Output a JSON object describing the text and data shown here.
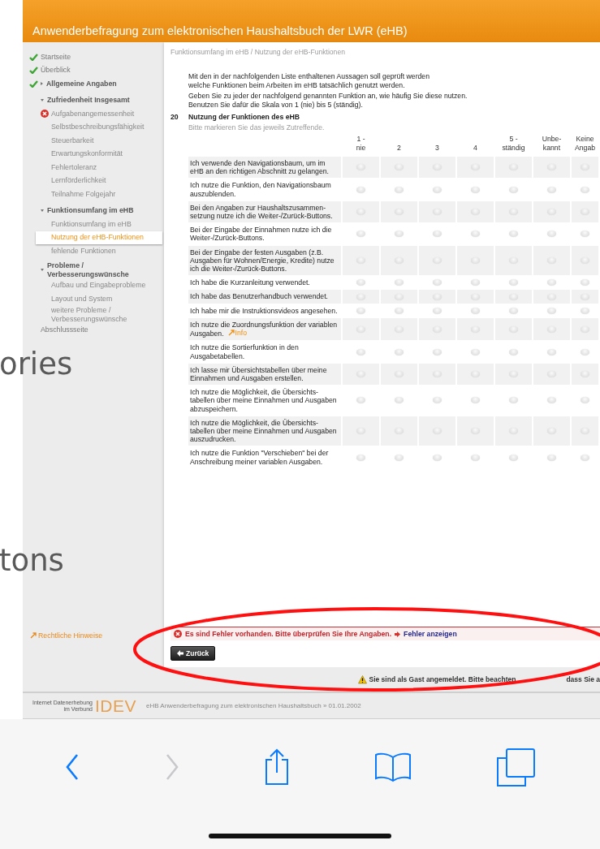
{
  "header": {
    "title": "Anwenderbefragung zum elektronischen Haushaltsbuch der LWR (eHB)"
  },
  "sidebar": {
    "items": [
      {
        "label": "Startseite",
        "kind": "page",
        "done": true,
        "error": false,
        "selected": false
      },
      {
        "label": "Überblick",
        "kind": "page",
        "done": true,
        "error": false,
        "selected": false
      },
      {
        "label": "Allgemeine Angaben",
        "kind": "group",
        "done": true,
        "error": false,
        "expanded": false,
        "selected": false
      },
      {
        "label": "Zufriedenheit Insgesamt",
        "kind": "group",
        "done": false,
        "error": false,
        "expanded": true,
        "selected": false,
        "children": [
          {
            "label": "Aufgabenangemessenheit",
            "done": false,
            "error": true,
            "selected": false
          },
          {
            "label": "Selbstbeschreibungsfähigkeit",
            "done": false,
            "error": false,
            "selected": false
          },
          {
            "label": "Steuerbarkeit",
            "done": false,
            "error": false,
            "selected": false
          },
          {
            "label": "Erwartungskonformität",
            "done": false,
            "error": false,
            "selected": false
          },
          {
            "label": "Fehlertoleranz",
            "done": false,
            "error": false,
            "selected": false
          },
          {
            "label": "Lernförderlichkeit",
            "done": false,
            "error": false,
            "selected": false
          },
          {
            "label": "Teilnahme Folgejahr",
            "done": false,
            "error": false,
            "selected": false
          }
        ]
      },
      {
        "label": "Funktionsumfang im eHB",
        "kind": "group",
        "done": false,
        "error": false,
        "expanded": true,
        "selected": false,
        "children": [
          {
            "label": "Funktionsumfang im eHB",
            "done": false,
            "error": false,
            "selected": false
          },
          {
            "label": "Nutzung der eHB-Funktionen",
            "done": false,
            "error": false,
            "selected": true
          },
          {
            "label": "fehlende Funktionen",
            "done": false,
            "error": false,
            "selected": false
          }
        ]
      },
      {
        "label": "Probleme / Verbesserungswünsche",
        "kind": "group",
        "done": false,
        "error": false,
        "expanded": true,
        "selected": false,
        "children": [
          {
            "label": "Aufbau und Eingabeprobleme",
            "done": false,
            "error": false,
            "selected": false
          },
          {
            "label": "Layout und System",
            "done": false,
            "error": false,
            "selected": false
          },
          {
            "label": "weitere Probleme / Verbesserungswünsche",
            "done": false,
            "error": false,
            "selected": false
          }
        ]
      },
      {
        "label": "Abschlussseite",
        "kind": "page",
        "done": false,
        "error": false,
        "selected": false
      }
    ],
    "legal_link": "Rechtliche Hinweise"
  },
  "content": {
    "breadcrumb": "Funktionsumfang im eHB / Nutzung der eHB-Funktionen",
    "paragraphs": [
      {
        "lines": [
          "Mit den in der nachfolgenden Liste enthaltenen Aussagen soll geprüft werden",
          "welche Funktionen beim Arbeiten im eHB tatsächlich genutzt werden."
        ]
      },
      {
        "lines": [
          "Geben Sie zu jeder der nachfolgend genannten Funktion an, wie häufig Sie diese nutzen.",
          "Benutzen Sie dafür die Skala von 1 (nie) bis 5 (ständig)."
        ]
      }
    ],
    "question": {
      "number": "20",
      "title": "Nutzung der Funktionen des eHB",
      "hint": "Bitte markieren Sie das jeweils Zutreffende."
    },
    "table": {
      "columns": [
        "1 -\nnie",
        "2",
        "3",
        "4",
        "5 -\nständig",
        "Unbe-\nkannt",
        "Keine\nAngab"
      ],
      "rows": [
        {
          "label": "Ich verwende den Navigationsbaum, um im eHB an den richtigen Abschnitt zu gelangen.",
          "radios": [
            {
              "selected": false
            },
            {
              "selected": false
            },
            {
              "selected": false
            },
            {
              "selected": false
            },
            {
              "selected": false
            },
            {
              "selected": false
            },
            {
              "selected": false
            }
          ]
        },
        {
          "label": "Ich nutze die Funktion, den Navigationsbaum auszublenden.",
          "radios": [
            {
              "selected": false
            },
            {
              "selected": false
            },
            {
              "selected": false
            },
            {
              "selected": false
            },
            {
              "selected": false
            },
            {
              "selected": false
            },
            {
              "selected": false
            }
          ]
        },
        {
          "label": "Bei den Angaben zur Haushaltszusammen-setzung nutze ich die Weiter-/Zurück-Buttons.",
          "radios": [
            {
              "selected": false
            },
            {
              "selected": false
            },
            {
              "selected": false
            },
            {
              "selected": false
            },
            {
              "selected": false
            },
            {
              "selected": false
            },
            {
              "selected": false
            }
          ]
        },
        {
          "label": "Bei der Eingabe der Einnahmen nutze ich die Weiter-/Zurück-Buttons.",
          "radios": [
            {
              "selected": false
            },
            {
              "selected": false
            },
            {
              "selected": false
            },
            {
              "selected": false
            },
            {
              "selected": false
            },
            {
              "selected": false
            },
            {
              "selected": false
            }
          ]
        },
        {
          "label": "Bei der Eingabe der festen Ausgaben (z.B. Ausgaben für Wohnen/Energie, Kredite) nutze ich die Weiter-/Zurück-Buttons.",
          "radios": [
            {
              "selected": false
            },
            {
              "selected": false
            },
            {
              "selected": false
            },
            {
              "selected": false
            },
            {
              "selected": false
            },
            {
              "selected": false
            },
            {
              "selected": false
            }
          ]
        },
        {
          "label": "Ich habe die Kurzanleitung verwendet.",
          "radios": [
            {
              "selected": false
            },
            {
              "selected": false
            },
            {
              "selected": false
            },
            {
              "selected": false
            },
            {
              "selected": false
            },
            {
              "selected": false
            },
            {
              "selected": false
            }
          ]
        },
        {
          "label": "Ich habe das Benutzerhandbuch verwendet.",
          "radios": [
            {
              "selected": false
            },
            {
              "selected": false
            },
            {
              "selected": false
            },
            {
              "selected": false
            },
            {
              "selected": false
            },
            {
              "selected": false
            },
            {
              "selected": false
            }
          ]
        },
        {
          "label": "Ich habe mir die Instruktionsvideos angesehen.",
          "radios": [
            {
              "selected": false
            },
            {
              "selected": false
            },
            {
              "selected": false
            },
            {
              "selected": false
            },
            {
              "selected": false
            },
            {
              "selected": false
            },
            {
              "selected": false
            }
          ]
        },
        {
          "label": "Ich nutze die Zuordnungsfunktion der variablen Ausgaben.",
          "link": "Info",
          "radios": [
            {
              "selected": false
            },
            {
              "selected": false
            },
            {
              "selected": false
            },
            {
              "selected": false
            },
            {
              "selected": false
            },
            {
              "selected": false
            },
            {
              "selected": false
            }
          ]
        },
        {
          "label": "Ich nutze die Sortierfunktion in den Ausgabetabellen.",
          "radios": [
            {
              "selected": false
            },
            {
              "selected": false
            },
            {
              "selected": false
            },
            {
              "selected": false
            },
            {
              "selected": false
            },
            {
              "selected": false
            },
            {
              "selected": false
            }
          ]
        },
        {
          "label": "Ich lasse mir Übersichtstabellen über meine Einnahmen und Ausgaben erstellen.",
          "radios": [
            {
              "selected": false
            },
            {
              "selected": false
            },
            {
              "selected": false
            },
            {
              "selected": false
            },
            {
              "selected": false
            },
            {
              "selected": false
            },
            {
              "selected": false
            }
          ]
        },
        {
          "label": "Ich nutze die Möglichkeit, die Übersichts-tabellen über meine Einnahmen und Ausgaben abzuspeichern.",
          "radios": [
            {
              "selected": false
            },
            {
              "selected": false
            },
            {
              "selected": false
            },
            {
              "selected": false
            },
            {
              "selected": false
            },
            {
              "selected": false
            },
            {
              "selected": false
            }
          ]
        },
        {
          "label": "Ich nutze die Möglichkeit, die Übersichts-tabellen über meine Einnahmen und Ausgaben auszudrucken.",
          "radios": [
            {
              "selected": false
            },
            {
              "selected": false
            },
            {
              "selected": false
            },
            {
              "selected": false
            },
            {
              "selected": false
            },
            {
              "selected": false
            },
            {
              "selected": false
            }
          ]
        },
        {
          "label": "Ich nutze die Funktion \"Verschieben\" bei der Anschreibung meiner variablen Ausgaben.",
          "radios": [
            {
              "selected": false
            },
            {
              "selected": false
            },
            {
              "selected": false
            },
            {
              "selected": false
            },
            {
              "selected": false
            },
            {
              "selected": false
            },
            {
              "selected": false
            }
          ]
        }
      ]
    },
    "error": {
      "message": "Es sind Fehler vorhanden. Bitte überprüfen Sie Ihre Angaben.",
      "link": "Fehler anzeigen"
    },
    "back_button": "Zurück"
  },
  "guest_notice": {
    "text": "Sie sind als Gast angemeldet. Bitte beachten",
    "continuation": "dass Sie a"
  },
  "footer": {
    "logo_line_1": "Internet Datenerhebung",
    "logo_line_2": "im Verbund",
    "logo_mark": "IDEV",
    "text": "eHB Anwenderbefragung zum elektronischen Haushaltsbuch » 01.01.2002"
  },
  "browser_toolbar": {
    "back_enabled": true,
    "forward_enabled": false
  },
  "overlay_texts": [
    {
      "text": "ories"
    },
    {
      "text": "tons"
    }
  ],
  "annotation": {
    "kind": "ellipse"
  }
}
